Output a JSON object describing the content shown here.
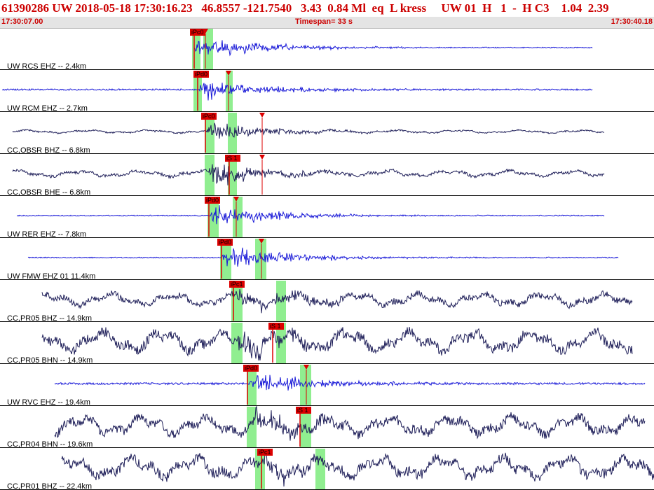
{
  "header": {
    "title": "61390286 UW 2018-05-18 17:30:16.23   46.8557 -121.7540   3.43  0.84 Ml  eq  L kress     UW 01  H   1  -  H C3    1.04  2.39",
    "start_time": "17:30:07.00",
    "timespan": "Timespan=  33 s",
    "end_time": "17:30:40.18"
  },
  "colors": {
    "title": "#cc0000",
    "waveform_ehz": "#1a1ad8",
    "waveform_other": "#20205a",
    "pick": "#dd0000",
    "window": "#90ee90",
    "divider": "#000000"
  },
  "traces": [
    {
      "label": "UW RCS EHZ -- 2.4km",
      "kind": "ehz",
      "sig_start": 277,
      "sig_end": 845,
      "amp": 20,
      "noise": 1,
      "onset": 277,
      "picks": [
        {
          "label": "iPc0",
          "t": 277,
          "kind": "P"
        },
        {
          "label": "",
          "t": 293,
          "kind": "S"
        }
      ],
      "windows": [
        [
          274,
          286
        ],
        [
          290,
          304
        ]
      ]
    },
    {
      "label": "UW RCM EHZ -- 2.7km",
      "kind": "ehz",
      "sig_start": 3,
      "sig_end": 845,
      "amp": 16,
      "noise": 1.5,
      "onset": 283,
      "picks": [
        {
          "label": "iPd0",
          "t": 282,
          "kind": "P"
        },
        {
          "label": "",
          "t": 326,
          "kind": "S"
        }
      ],
      "windows": [
        [
          276,
          288
        ],
        [
          322,
          332
        ]
      ]
    },
    {
      "label": "CC,OBSR BHZ -- 6.8km",
      "kind": "other",
      "sig_start": 18,
      "sig_end": 862,
      "amp": 14,
      "noise": 1.5,
      "onset": 294,
      "picks": [
        {
          "label": "iPc0",
          "t": 293,
          "kind": "P"
        },
        {
          "label": "",
          "t": 374,
          "kind": "S"
        }
      ],
      "windows": [
        [
          292,
          306
        ],
        [
          325,
          338
        ]
      ]
    },
    {
      "label": "CC,OBSR BHE -- 6.8km",
      "kind": "other",
      "sig_start": 18,
      "sig_end": 862,
      "amp": 16,
      "noise": 3,
      "onset": 296,
      "picks": [
        {
          "label": "iS 1",
          "t": 327,
          "kind": "P"
        },
        {
          "label": "",
          "t": 374,
          "kind": "S"
        }
      ],
      "windows": [
        [
          292,
          306
        ],
        [
          325,
          338
        ]
      ]
    },
    {
      "label": "UW RER EHZ -- 7.8km",
      "kind": "ehz",
      "sig_start": 24,
      "sig_end": 862,
      "amp": 18,
      "noise": 1,
      "onset": 300,
      "picks": [
        {
          "label": "iPd0",
          "t": 298,
          "kind": "P"
        },
        {
          "label": "",
          "t": 337,
          "kind": "S"
        }
      ],
      "windows": [
        [
          296,
          312
        ],
        [
          332,
          346
        ]
      ]
    },
    {
      "label": "UW FMW EHZ 01 11.4km",
      "kind": "ehz",
      "sig_start": 40,
      "sig_end": 882,
      "amp": 20,
      "noise": 1,
      "onset": 316,
      "picks": [
        {
          "label": "iPd0",
          "t": 316,
          "kind": "P"
        },
        {
          "label": "",
          "t": 373,
          "kind": "S"
        }
      ],
      "windows": [
        [
          314,
          330
        ],
        [
          364,
          380
        ]
      ]
    },
    {
      "label": "CC,PR05 BHZ -- 14.9km",
      "kind": "other",
      "sig_start": 60,
      "sig_end": 902,
      "amp": 14,
      "noise": 6,
      "onset": 333,
      "picks": [
        {
          "label": "iPc1",
          "t": 333,
          "kind": "P"
        }
      ],
      "windows": [
        [
          330,
          346
        ],
        [
          394,
          408
        ]
      ]
    },
    {
      "label": "CC,PR05 BHN -- 14.9km",
      "kind": "other",
      "sig_start": 60,
      "sig_end": 902,
      "amp": 16,
      "noise": 10,
      "onset": 336,
      "picks": [
        {
          "label": "iS 1",
          "t": 389,
          "kind": "P"
        }
      ],
      "windows": [
        [
          330,
          346
        ],
        [
          394,
          408
        ]
      ]
    },
    {
      "label": "UW RVC EHZ -- 19.4km",
      "kind": "ehz",
      "sig_start": 78,
      "sig_end": 920,
      "amp": 18,
      "noise": 2,
      "onset": 355,
      "picks": [
        {
          "label": "iPd0",
          "t": 353,
          "kind": "P"
        },
        {
          "label": "",
          "t": 437,
          "kind": "S"
        }
      ],
      "windows": [
        [
          352,
          366
        ],
        [
          428,
          444
        ]
      ]
    },
    {
      "label": "CC,PR04 BHN -- 19.6km",
      "kind": "other",
      "sig_start": 78,
      "sig_end": 920,
      "amp": 18,
      "noise": 9,
      "onset": 358,
      "picks": [
        {
          "label": "iS 1",
          "t": 428,
          "kind": "P"
        }
      ],
      "windows": [
        [
          352,
          366
        ],
        [
          428,
          444
        ]
      ]
    },
    {
      "label": "CC,PR01 BHZ -- 22.4km",
      "kind": "other",
      "sig_start": 88,
      "sig_end": 933,
      "amp": 16,
      "noise": 10,
      "onset": 370,
      "picks": [
        {
          "label": "iPc1",
          "t": 373,
          "kind": "P"
        }
      ],
      "windows": [
        [
          364,
          378
        ],
        [
          450,
          464
        ]
      ]
    }
  ]
}
